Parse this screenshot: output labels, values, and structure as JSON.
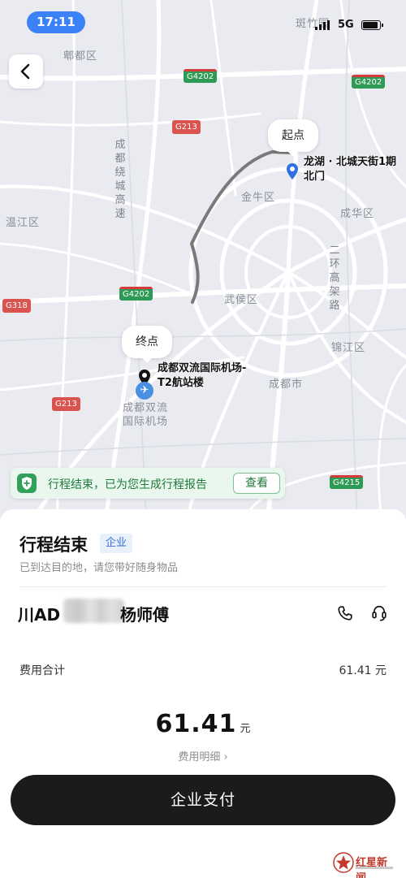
{
  "status_bar": {
    "time": "17:11",
    "network": "5G"
  },
  "map": {
    "districts": {
      "pidu": "郫都区",
      "jinniu": "金牛区",
      "chenghua": "成华区",
      "wenjiang": "温江区",
      "wuhou": "武侯区",
      "jinjiang": "锦江区",
      "chengdu": "成都市",
      "shuangliu_airport": [
        "成都双流",
        "国际机场"
      ],
      "top_partial": "斑竹园"
    },
    "road_labels": {
      "ring_expressway": "成都绕城高速",
      "second_ring": "二环高架路"
    },
    "shields": {
      "g4202_a": "G4202",
      "g4202_b": "G4202",
      "g4202_c": "G4202",
      "g213_a": "G213",
      "g213_b": "G213",
      "g318": "G318",
      "g4215": "G4215"
    },
    "start": {
      "bubble": "起点",
      "name_line1": "龙湖 · 北城天街1期",
      "name_line2": "北门"
    },
    "end": {
      "bubble": "终点",
      "name_line1": "成都双流国际机场-",
      "name_line2": "T2航站楼"
    },
    "colors": {
      "route": "#7a7a7a",
      "start_pin": "#2f6fe0",
      "road": "#ffffff",
      "map_bg": "#e9ebf0"
    }
  },
  "report_banner": {
    "text": "行程结束，已为您生成行程报告",
    "action": "查看"
  },
  "trip": {
    "title": "行程结束",
    "tag": "企业",
    "subtitle": "已到达目的地，请您带好随身物品",
    "plate": "川AD",
    "driver": "杨师傅"
  },
  "fee": {
    "label": "费用合计",
    "total": "61.41 元",
    "amount": "61.41",
    "unit": "元",
    "detail_link": "费用明细 ›"
  },
  "actions": {
    "pay": "企业支付"
  },
  "watermark": {
    "text": "红星新闻"
  }
}
